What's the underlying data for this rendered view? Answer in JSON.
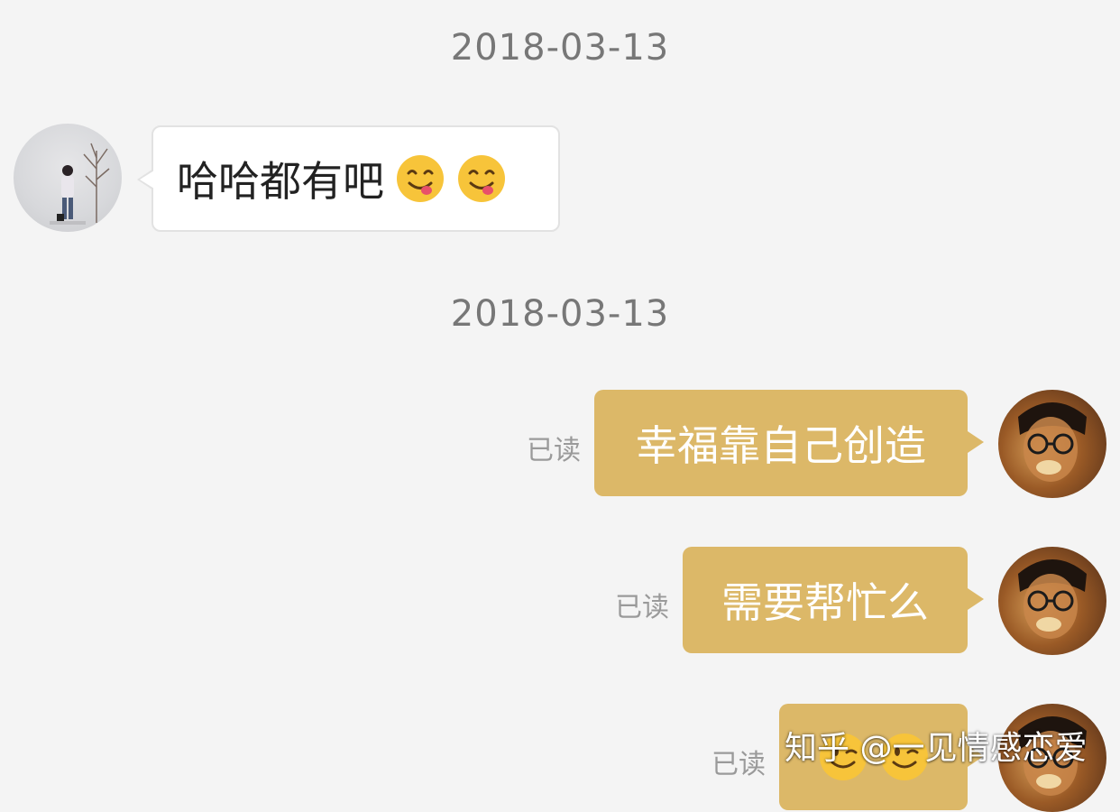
{
  "timestamps": [
    "2018-03-13",
    "2018-03-13"
  ],
  "messages": [
    {
      "side": "left",
      "text": "哈哈都有吧",
      "emojis": [
        "face-savoring-food-icon",
        "face-savoring-food-icon"
      ]
    },
    {
      "side": "right",
      "text": "幸福靠自己创造",
      "status": "已读"
    },
    {
      "side": "right",
      "text": "需要帮忙么",
      "status": "已读"
    },
    {
      "side": "right",
      "text": "",
      "emojis": [
        "winking-face-icon",
        "winking-face-icon"
      ],
      "status": "已读"
    }
  ],
  "watermark": "知乎 @一见情感恋爱",
  "colors": {
    "background": "#f4f4f4",
    "sent_bubble": "#dcb868",
    "received_bubble": "#ffffff",
    "timestamp_text": "#777777",
    "read_text": "#9a9a9a"
  }
}
